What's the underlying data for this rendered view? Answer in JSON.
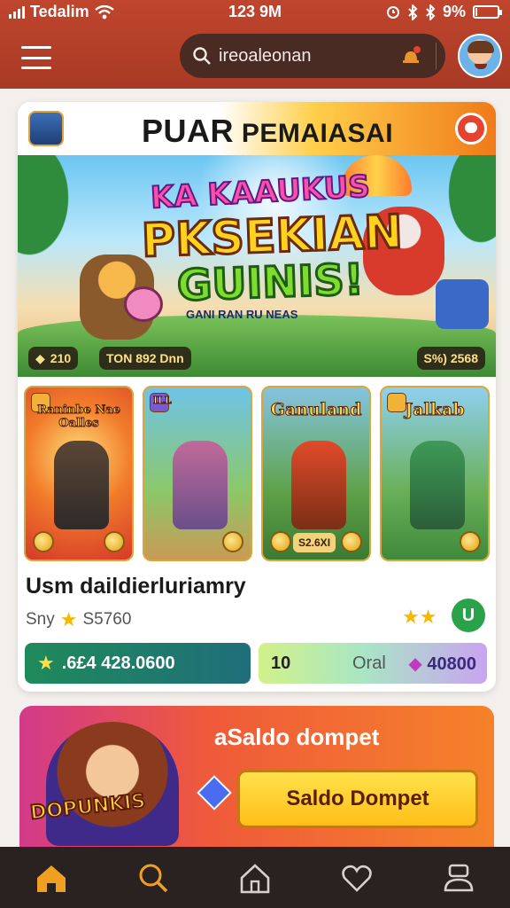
{
  "status_bar": {
    "carrier": "Tedalim",
    "time": "123 9M",
    "battery": "9%",
    "battery_level": 0.09
  },
  "header": {
    "search_value": "ireoaleonan"
  },
  "card": {
    "title_a": "PUAR",
    "title_b": "PEMAIASAI",
    "hero": {
      "line1": "KA KAAUKUS",
      "line2": "PKSEKIAN",
      "line3": "GUINIS!",
      "subtitle": "GANI RAN RU NEAS",
      "chip1": "210",
      "chip2": "TON 892 Dnn",
      "chip3": "S%) 2568"
    },
    "tiles": [
      {
        "label": "Raninbe Nae Oalles"
      },
      {
        "label": "ILL"
      },
      {
        "label": "Ganuland",
        "pill": "S2.6XI"
      },
      {
        "label": "Jalkab"
      }
    ],
    "info_title": "Usm daildierluriamry",
    "info_sub_prefix": "Sny",
    "info_sub_value": "S5760",
    "u_badge": "U",
    "stat_a": ".6£4 428.0600",
    "stat_b_num": "10",
    "stat_b_mid": "Oral",
    "stat_b_end": "40800"
  },
  "promo": {
    "tag": "DOPUNKIS",
    "title": "aSaldo dompet",
    "button": "Saldo Dompet"
  },
  "colors": {
    "header": "#c0452d",
    "nav_bg": "#2a2220",
    "nav_active": "#f0a020",
    "nav_inactive": "#d8d0cc"
  },
  "nav": {
    "items": [
      "home-icon",
      "search-icon",
      "house-icon",
      "heart-icon",
      "profile-icon"
    ],
    "active": "home-icon"
  }
}
